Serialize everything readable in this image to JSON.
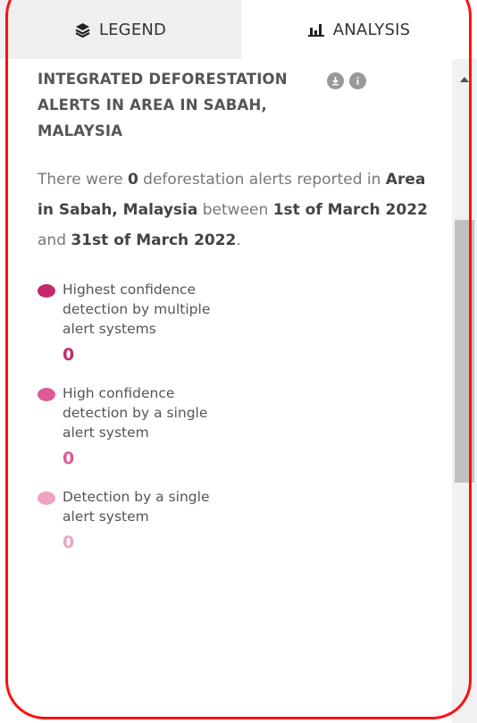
{
  "tabs": {
    "legend_label": "LEGEND",
    "analysis_label": "ANALYSIS"
  },
  "widget": {
    "title": "INTEGRATED DEFORESTATION ALERTS IN AREA IN SABAH, MALAYSIA",
    "summary": {
      "p1": "There were ",
      "count": "0",
      "p2": " deforestation alerts reported in ",
      "area": "Area in Sabah, Malaysia",
      "p3": " between ",
      "start": "1st of March 2022",
      "p4": " and ",
      "end": "31st of March 2022",
      "p5": "."
    },
    "items": [
      {
        "label": "Highest confidence detection by multiple alert systems",
        "value": "0",
        "color": "#c4296b"
      },
      {
        "label": "High confidence detection by a single alert system",
        "value": "0",
        "color": "#de5a96"
      },
      {
        "label": "Detection by a single alert system",
        "value": "0",
        "color": "#eda3c2"
      }
    ]
  },
  "colors": {
    "frame": "#ff1010",
    "tab_inactive_bg": "#efefef",
    "scrollbar_thumb": "#c1c1c1"
  },
  "icons": [
    "layers-icon",
    "bar-chart-icon",
    "download-icon",
    "info-icon",
    "scroll-up-arrow-icon"
  ]
}
